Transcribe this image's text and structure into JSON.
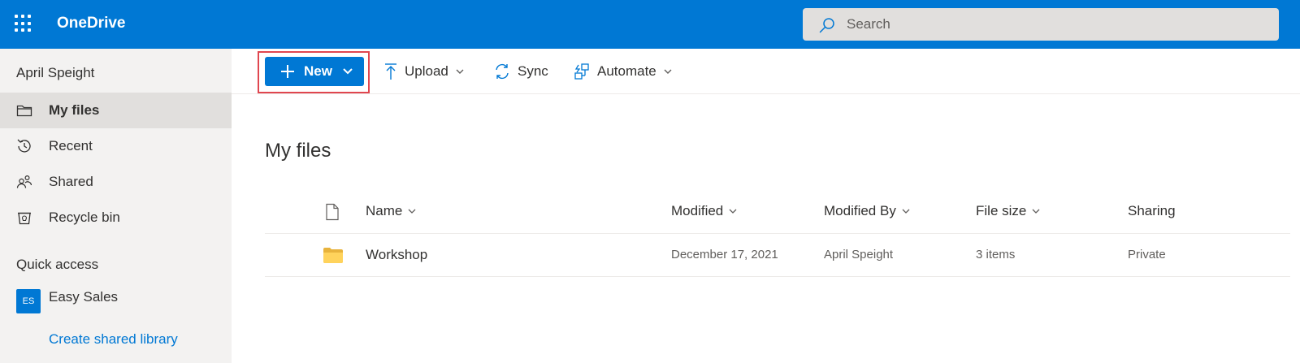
{
  "app": {
    "title": "OneDrive"
  },
  "search": {
    "placeholder": "Search"
  },
  "sidebar": {
    "user": "April Speight",
    "items": [
      {
        "label": "My files",
        "icon": "folder-icon",
        "active": true
      },
      {
        "label": "Recent",
        "icon": "clock-icon"
      },
      {
        "label": "Shared",
        "icon": "people-icon"
      },
      {
        "label": "Recycle bin",
        "icon": "recycle-bin-icon"
      }
    ],
    "quick_access_label": "Quick access",
    "quick_access_items": [
      {
        "label": "Easy Sales",
        "badge": "ES"
      }
    ],
    "create_library_label": "Create shared library"
  },
  "toolbar": {
    "new_label": "New",
    "upload_label": "Upload",
    "sync_label": "Sync",
    "automate_label": "Automate"
  },
  "main": {
    "title": "My files",
    "columns": [
      "Name",
      "Modified",
      "Modified By",
      "File size",
      "Sharing"
    ],
    "rows": [
      {
        "name": "Workshop",
        "modified": "December 17, 2021",
        "modified_by": "April Speight",
        "file_size": "3 items",
        "sharing": "Private"
      }
    ]
  },
  "colors": {
    "brand": "#0078d4",
    "highlight": "#e0464f",
    "folder": "#ffd35c"
  }
}
